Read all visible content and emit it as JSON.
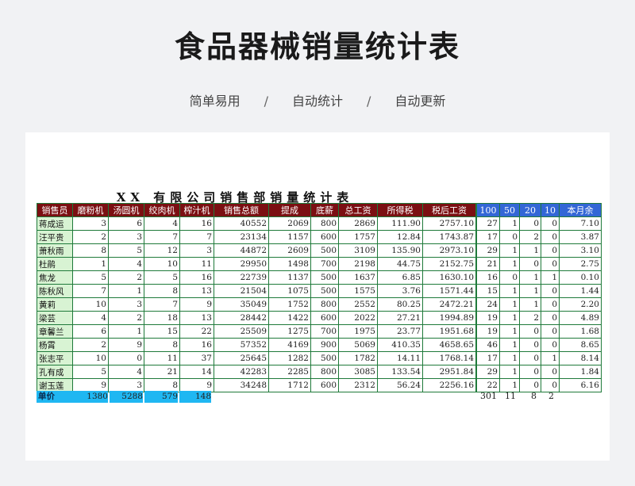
{
  "header": {
    "title": "食品器械销量统计表",
    "tags": [
      "简单易用",
      "自动统计",
      "自动更新"
    ],
    "separator": "/"
  },
  "sheet": {
    "title": "XX 有限公司销售部销量统计表",
    "main_columns": [
      "销售员",
      "磨粉机",
      "汤圆机",
      "绞肉机",
      "榨汁机",
      "销售总额",
      "提成",
      "底薪",
      "总工资",
      "所得税",
      "税后工资"
    ],
    "side_columns": [
      "100",
      "50",
      "20",
      "10",
      "本月余"
    ],
    "rows": [
      {
        "name": "蒋成运",
        "m1": "3",
        "m2": "6",
        "m3": "4",
        "m4": "16",
        "sales": "40552",
        "commission": "2069",
        "base": "800",
        "total": "2869",
        "tax": "111.90",
        "net": "2757.10",
        "d100": "27",
        "d50": "1",
        "d20": "0",
        "d10": "0",
        "rest": "7.10"
      },
      {
        "name": "汪平贵",
        "m1": "2",
        "m2": "3",
        "m3": "7",
        "m4": "7",
        "sales": "23134",
        "commission": "1157",
        "base": "600",
        "total": "1757",
        "tax": "12.84",
        "net": "1743.87",
        "d100": "17",
        "d50": "0",
        "d20": "2",
        "d10": "0",
        "rest": "3.87"
      },
      {
        "name": "萧秋雨",
        "m1": "8",
        "m2": "5",
        "m3": "12",
        "m4": "3",
        "sales": "44872",
        "commission": "2609",
        "base": "500",
        "total": "3109",
        "tax": "135.90",
        "net": "2973.10",
        "d100": "29",
        "d50": "1",
        "d20": "1",
        "d10": "0",
        "rest": "3.10"
      },
      {
        "name": "杜鹃",
        "m1": "1",
        "m2": "4",
        "m3": "10",
        "m4": "11",
        "sales": "29950",
        "commission": "1498",
        "base": "700",
        "total": "2198",
        "tax": "44.75",
        "net": "2152.75",
        "d100": "21",
        "d50": "1",
        "d20": "0",
        "d10": "0",
        "rest": "2.75"
      },
      {
        "name": "焦龙",
        "m1": "5",
        "m2": "2",
        "m3": "5",
        "m4": "16",
        "sales": "22739",
        "commission": "1137",
        "base": "500",
        "total": "1637",
        "tax": "6.85",
        "net": "1630.10",
        "d100": "16",
        "d50": "0",
        "d20": "1",
        "d10": "1",
        "rest": "0.10"
      },
      {
        "name": "陈秋风",
        "m1": "7",
        "m2": "1",
        "m3": "8",
        "m4": "13",
        "sales": "21504",
        "commission": "1075",
        "base": "500",
        "total": "1575",
        "tax": "3.76",
        "net": "1571.44",
        "d100": "15",
        "d50": "1",
        "d20": "1",
        "d10": "0",
        "rest": "1.44"
      },
      {
        "name": "黄莉",
        "m1": "10",
        "m2": "3",
        "m3": "7",
        "m4": "9",
        "sales": "35049",
        "commission": "1752",
        "base": "800",
        "total": "2552",
        "tax": "80.25",
        "net": "2472.21",
        "d100": "24",
        "d50": "1",
        "d20": "1",
        "d10": "0",
        "rest": "2.20"
      },
      {
        "name": "梁芸",
        "m1": "4",
        "m2": "2",
        "m3": "18",
        "m4": "13",
        "sales": "28442",
        "commission": "1422",
        "base": "600",
        "total": "2022",
        "tax": "27.21",
        "net": "1994.89",
        "d100": "19",
        "d50": "1",
        "d20": "2",
        "d10": "0",
        "rest": "4.89"
      },
      {
        "name": "章馨兰",
        "m1": "6",
        "m2": "1",
        "m3": "15",
        "m4": "22",
        "sales": "25509",
        "commission": "1275",
        "base": "700",
        "total": "1975",
        "tax": "23.77",
        "net": "1951.68",
        "d100": "19",
        "d50": "1",
        "d20": "0",
        "d10": "0",
        "rest": "1.68"
      },
      {
        "name": "杨霄",
        "m1": "2",
        "m2": "9",
        "m3": "8",
        "m4": "16",
        "sales": "57352",
        "commission": "4169",
        "base": "900",
        "total": "5069",
        "tax": "410.35",
        "net": "4658.65",
        "d100": "46",
        "d50": "1",
        "d20": "0",
        "d10": "0",
        "rest": "8.65"
      },
      {
        "name": "张志平",
        "m1": "10",
        "m2": "0",
        "m3": "11",
        "m4": "37",
        "sales": "25645",
        "commission": "1282",
        "base": "500",
        "total": "1782",
        "tax": "14.11",
        "net": "1768.14",
        "d100": "17",
        "d50": "1",
        "d20": "0",
        "d10": "1",
        "rest": "8.14"
      },
      {
        "name": "孔有成",
        "m1": "5",
        "m2": "4",
        "m3": "21",
        "m4": "14",
        "sales": "42283",
        "commission": "2285",
        "base": "800",
        "total": "3085",
        "tax": "133.54",
        "net": "2951.84",
        "d100": "29",
        "d50": "1",
        "d20": "0",
        "d10": "0",
        "rest": "1.84"
      },
      {
        "name": "谢玉莲",
        "m1": "9",
        "m2": "3",
        "m3": "8",
        "m4": "9",
        "sales": "34248",
        "commission": "1712",
        "base": "600",
        "total": "2312",
        "tax": "56.24",
        "net": "2256.16",
        "d100": "22",
        "d50": "1",
        "d20": "0",
        "d10": "0",
        "rest": "6.16"
      }
    ],
    "unit_price": {
      "label": "单价",
      "m1": "1380",
      "m2": "5288",
      "m3": "579",
      "m4": "148"
    },
    "totals": {
      "d100": "301",
      "d50": "11",
      "d20": "8",
      "d10": "2"
    }
  },
  "colors": {
    "main_header": "#7b0f12",
    "side_header": "#3367d6",
    "name_cell": "#d8f3d3",
    "unit_price": "#1fb7f2",
    "border": "#1f7a3a"
  }
}
